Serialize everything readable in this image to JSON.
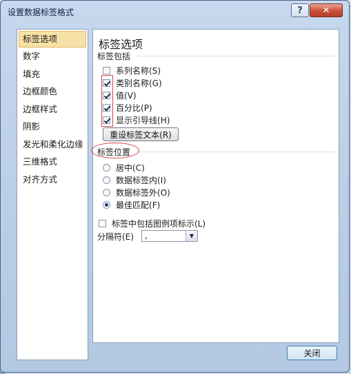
{
  "window": {
    "title": "设置数据标签格式",
    "help_glyph": "?",
    "close_glyph": "✕"
  },
  "sidebar": {
    "items": [
      {
        "label": "标签选项",
        "active": true
      },
      {
        "label": "数字"
      },
      {
        "label": "填充"
      },
      {
        "label": "边框颜色"
      },
      {
        "label": "边框样式"
      },
      {
        "label": "阴影"
      },
      {
        "label": "发光和柔化边缘"
      },
      {
        "label": "三维格式"
      },
      {
        "label": "对齐方式"
      }
    ]
  },
  "panel": {
    "title": "标签选项",
    "contains_section": "标签包括",
    "contains": [
      {
        "label": "系列名称",
        "key": "S",
        "checked": false
      },
      {
        "label": "类别名称",
        "key": "G",
        "checked": true
      },
      {
        "label": "值",
        "key": "V",
        "checked": true
      },
      {
        "label": "百分比",
        "key": "P",
        "checked": true
      },
      {
        "label": "显示引导线",
        "key": "H",
        "checked": true
      }
    ],
    "reset_button": "重设标签文本(R)",
    "position_section": "标签位置",
    "positions": [
      {
        "label": "居中",
        "key": "C",
        "selected": false
      },
      {
        "label": "数据标签内",
        "key": "I",
        "selected": false
      },
      {
        "label": "数据标签外",
        "key": "O",
        "selected": false
      },
      {
        "label": "最佳匹配",
        "key": "F",
        "selected": true
      }
    ],
    "legend_key_label": "标签中包括图例项标示(L)",
    "legend_key_checked": false,
    "separator_label": "分隔符(E)",
    "separator_value": ","
  },
  "footer": {
    "close_label": "关闭"
  },
  "colors": {
    "annotation_red": "#d04848",
    "active_nav": "#f7e1a6"
  }
}
